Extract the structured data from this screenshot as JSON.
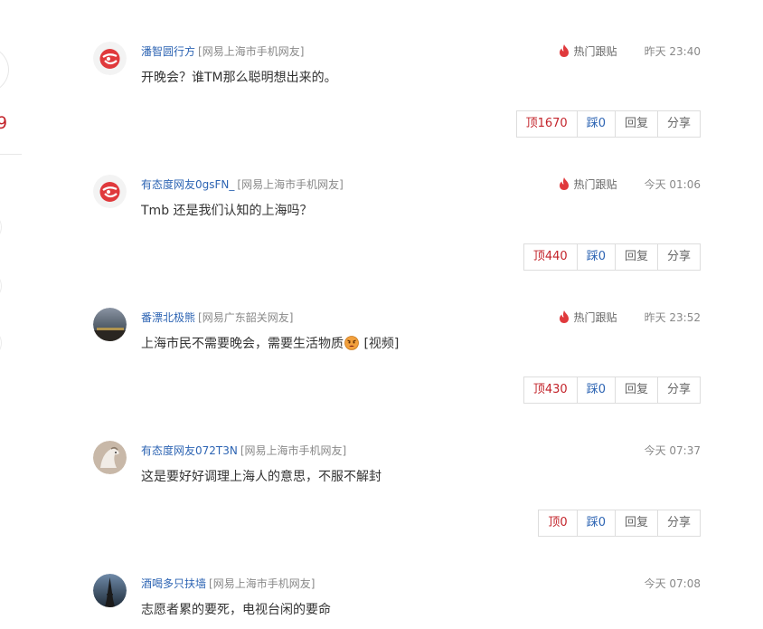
{
  "sidebar_partial": {
    "count_fragment": "9"
  },
  "hot_icon": "flame-icon",
  "comments": [
    {
      "avatar": "netease-logo",
      "username": "潘智圆行方",
      "location": "[网易上海市手机网友]",
      "hot_label": "热门跟贴",
      "time": "昨天 23:40",
      "text": "开晚会？谁TM那么聪明想出来的。",
      "up": "顶1670",
      "down": "踩0",
      "reply": "回复",
      "share": "分享"
    },
    {
      "avatar": "netease-logo",
      "username": "有态度网友0gsFN_",
      "location": "[网易上海市手机网友]",
      "hot_label": "热门跟贴",
      "time": "今天 01:06",
      "text": "Tmb 还是我们认知的上海吗？",
      "up": "顶440",
      "down": "踩0",
      "reply": "回复",
      "share": "分享"
    },
    {
      "avatar": "landscape-photo",
      "username": "番漂北极熊",
      "location": "[网易广东韶关网友]",
      "hot_label": "热门跟贴",
      "time": "昨天 23:52",
      "text_before": "上海市民不需要晚会，需要生活物质",
      "emoji": "angry-face-emoji",
      "text_after": " [视频]",
      "up": "顶430",
      "down": "踩0",
      "reply": "回复",
      "share": "分享"
    },
    {
      "avatar": "horse-photo",
      "username": "有态度网友072T3N",
      "location": "[网易上海市手机网友]",
      "time": "今天 07:37",
      "text": "这是要好好调理上海人的意思，不服不解封",
      "up": "顶0",
      "down": "踩0",
      "reply": "回复",
      "share": "分享"
    },
    {
      "avatar": "tower-photo",
      "username": "酒喝多只扶墙",
      "location": "[网易上海市手机网友]",
      "time": "今天 07:08",
      "text": "志愿者累的要死，电视台闲的要命"
    }
  ]
}
